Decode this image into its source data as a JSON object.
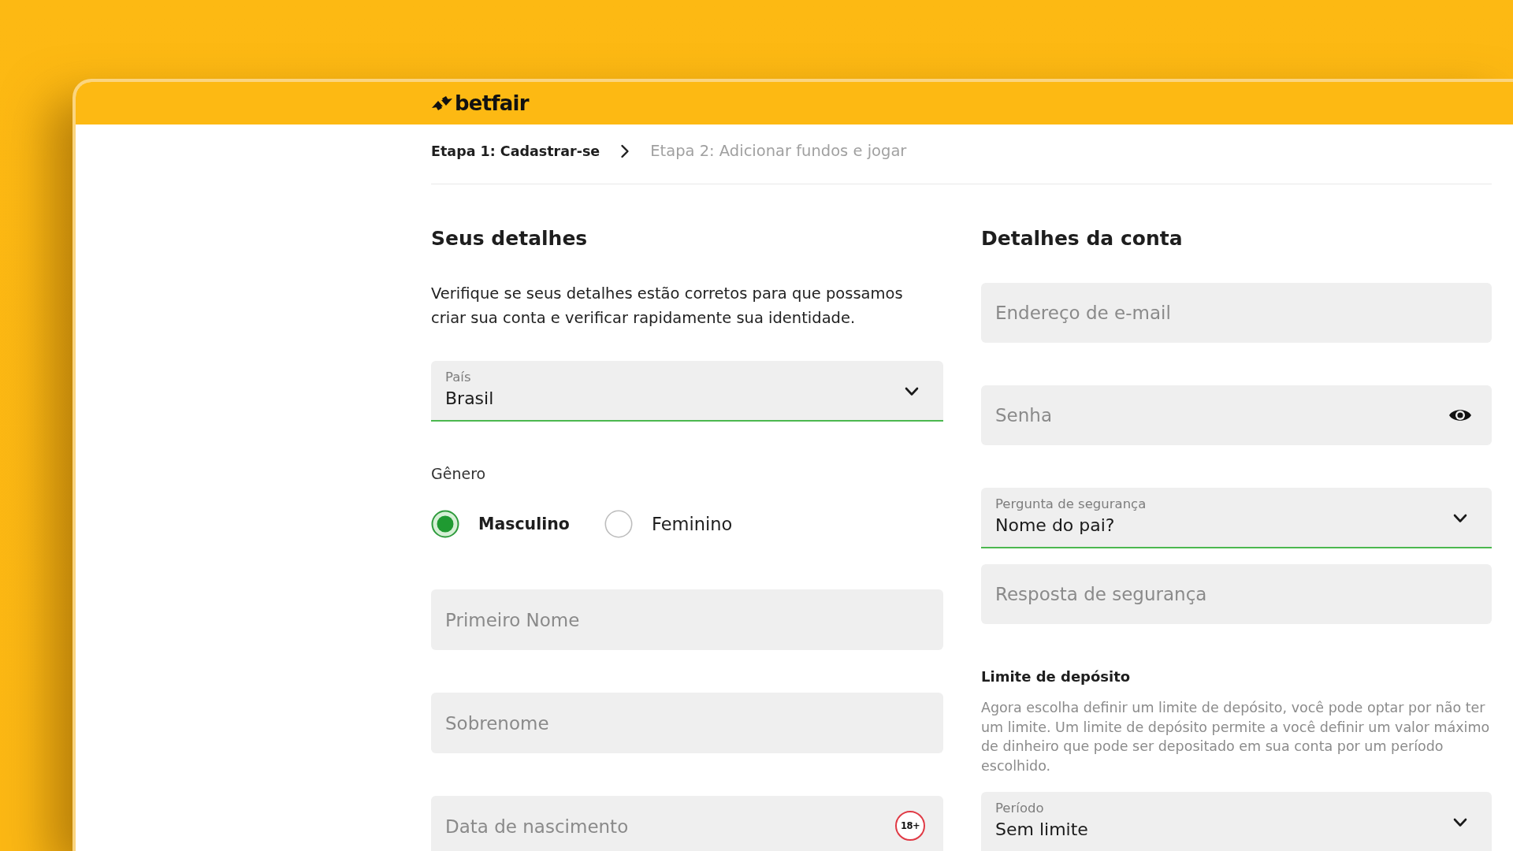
{
  "header": {
    "logo": "betfair"
  },
  "steps": [
    {
      "label": "Etapa 1: Cadastrar-se",
      "active": true
    },
    {
      "label": "Etapa 2: Adicionar fundos e jogar",
      "active": false
    }
  ],
  "personal": {
    "title": "Seus detalhes",
    "intro": "Verifique se seus detalhes estão corretos para que possamos criar sua conta e verificar rapidamente sua identidade.",
    "country": {
      "label": "País",
      "value": "Brasil"
    },
    "gender": {
      "label": "Gênero",
      "options": [
        {
          "label": "Masculino",
          "selected": true
        },
        {
          "label": "Feminino",
          "selected": false
        }
      ]
    },
    "first_name": {
      "placeholder": "Primeiro Nome"
    },
    "last_name": {
      "placeholder": "Sobrenome"
    },
    "birth_date": {
      "placeholder": "Data de nascimento",
      "badge": "18+"
    }
  },
  "account": {
    "title": "Detalhes da conta",
    "email": {
      "placeholder": "Endereço de e-mail"
    },
    "password": {
      "placeholder": "Senha"
    },
    "security_question": {
      "label": "Pergunta de segurança",
      "value": "Nome do pai?"
    },
    "security_answer": {
      "placeholder": "Resposta de segurança"
    },
    "deposit_limit": {
      "title": "Limite de depósito",
      "description": "Agora escolha definir um limite de depósito, você pode optar por não ter um limite. Um limite de depósito permite a você definir um valor máximo de dinheiro que pode ser depositado em sua conta por um período escolhido.",
      "period": {
        "label": "Período",
        "value": "Sem limite"
      }
    }
  }
}
